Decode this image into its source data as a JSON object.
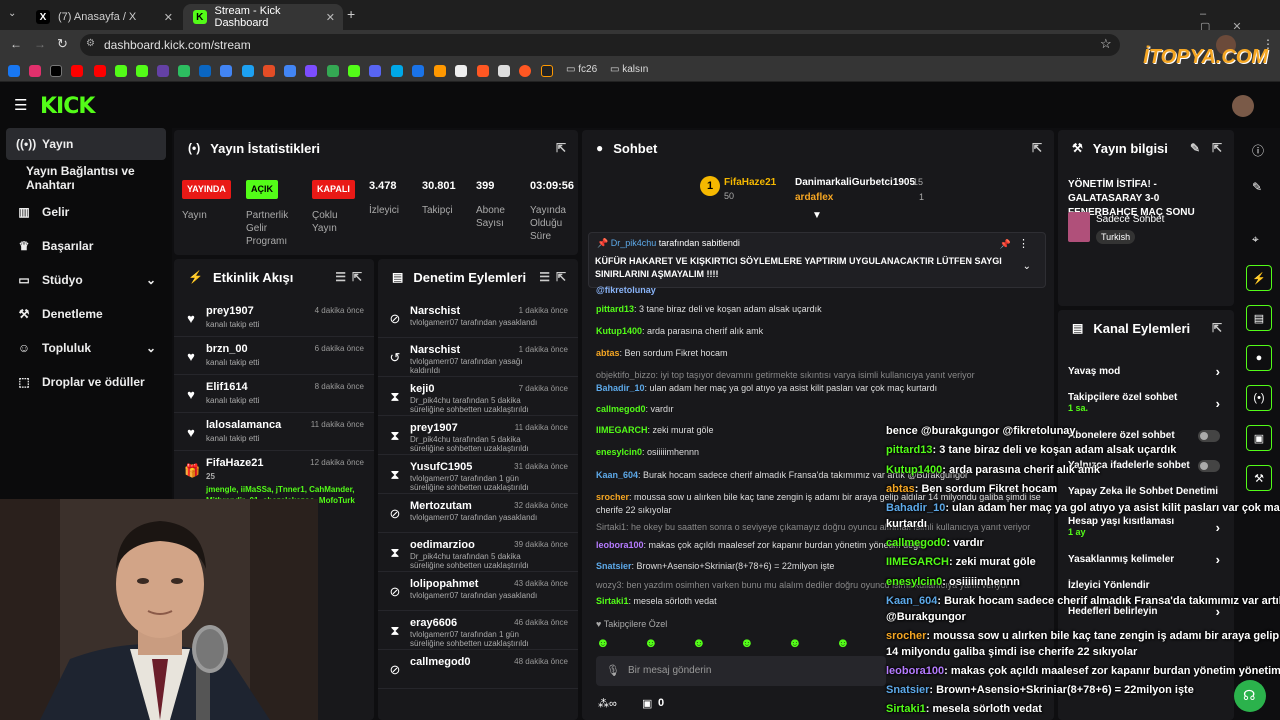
{
  "browser": {
    "tabs": [
      {
        "title": "(7) Anasayfa / X",
        "icon": "x-logo-icon",
        "active": false
      },
      {
        "title": "Stream - Kick Dashboard",
        "icon": "kick-logo-icon",
        "active": true
      }
    ],
    "url": "dashboard.kick.com/stream",
    "bookmarks": [
      {
        "label": "fc26"
      },
      {
        "label": "kalsın"
      }
    ],
    "watermark": "İTOPYA.COM"
  },
  "sidebar": {
    "items": [
      {
        "label": "Yayın",
        "icon": "broadcast-icon"
      },
      {
        "label": "Yayın Bağlantısı ve Anahtarı",
        "icon": ""
      },
      {
        "label": "Gelir",
        "icon": "chart-icon"
      },
      {
        "label": "Başarılar",
        "icon": "trophy-icon"
      },
      {
        "label": "Stüdyo",
        "icon": "studio-icon"
      },
      {
        "label": "Denetleme",
        "icon": "wrench-icon"
      },
      {
        "label": "Topluluk",
        "icon": "community-icon"
      },
      {
        "label": "Droplar ve ödüller",
        "icon": "drops-icon"
      }
    ]
  },
  "stats": {
    "title": "Yayın İstatistikleri",
    "badges": [
      {
        "badge": "YAYINDA",
        "label": "Yayın",
        "color": "#e91916"
      },
      {
        "badge": "AÇIK",
        "label": "Partnerlik Gelir Programı",
        "color": "#53fc18"
      },
      {
        "badge": "KAPALI",
        "label": "Çoklu Yayın",
        "color": "#e91916"
      }
    ],
    "numbers": [
      {
        "value": "3.478",
        "label": "İzleyici"
      },
      {
        "value": "30.801",
        "label": "Takipçi"
      },
      {
        "value": "399",
        "label": "Abone Sayısı"
      },
      {
        "value": "03:09:56",
        "label": "Yayında Olduğu Süre"
      }
    ]
  },
  "activity": {
    "title": "Etkinlik Akışı",
    "items": [
      {
        "name": "prey1907",
        "sub": "kanalı takip etti",
        "time": "4 dakika önce"
      },
      {
        "name": "brzn_00",
        "sub": "kanalı takip etti",
        "time": "6 dakika önce"
      },
      {
        "name": "Elif1614",
        "sub": "kanalı takip etti",
        "time": "8 dakika önce"
      },
      {
        "name": "lalosalamanca",
        "sub": "kanalı takip etti",
        "time": "11 dakika önce"
      },
      {
        "name": "FifaHaze21",
        "sub": "25",
        "time": "12 dakika önce"
      }
    ],
    "gift_names": "jmengle, iiMaSSa, jTnner1, CahMander, Mithrandir_01, shazalakazoo, MofoTurk"
  },
  "moderation": {
    "title": "Denetim Eylemleri",
    "items": [
      {
        "name": "Narschist",
        "sub": "tvlolgamerr07 tarafından yasaklandı",
        "time": "1 dakika önce",
        "icon": "ban-icon"
      },
      {
        "name": "Narschist",
        "sub": "tvlolgamerr07 tarafından yasağı kaldırıldı",
        "time": "1 dakika önce",
        "icon": "unban-icon"
      },
      {
        "name": "keji0",
        "sub": "Dr_pik4chu tarafından 5 dakika süreliğine sohbetten uzaklaştırıldı",
        "time": "7 dakika önce",
        "icon": "timeout-icon"
      },
      {
        "name": "prey1907",
        "sub": "Dr_pik4chu tarafından 5 dakika süreliğine sohbetten uzaklaştırıldı",
        "time": "11 dakika önce",
        "icon": "timeout-icon"
      },
      {
        "name": "YusufC1905",
        "sub": "tvlolgamerr07 tarafından 1 gün süreliğine sohbetten uzaklaştırıldı",
        "time": "31 dakika önce",
        "icon": "timeout-icon"
      },
      {
        "name": "Mertozutam",
        "sub": "tvlolgamerr07 tarafından yasaklandı",
        "time": "32 dakika önce",
        "icon": "ban-icon"
      },
      {
        "name": "oedimarzioo",
        "sub": "Dr_pik4chu tarafından 5 dakika süreliğine sohbetten uzaklaştırıldı",
        "time": "39 dakika önce",
        "icon": "timeout-icon"
      },
      {
        "name": "lolipopahmet",
        "sub": "tvlolgamerr07 tarafından yasaklandı",
        "time": "43 dakika önce",
        "icon": "ban-icon"
      },
      {
        "name": "eray6606",
        "sub": "tvlolgamerr07 tarafından 1 gün süreliğine sohbetten uzaklaştırıldı",
        "time": "46 dakika önce",
        "icon": "timeout-icon"
      },
      {
        "name": "callmegod0",
        "sub": "",
        "time": "48 dakika önce",
        "icon": "ban-icon"
      }
    ]
  },
  "chat": {
    "title": "Sohbet",
    "top": [
      {
        "name": "FifaHaze21",
        "count": "50"
      },
      {
        "name": "DanimarkaliGurbetci1905",
        "count": "15"
      },
      {
        "name": "ardaflex",
        "count": "1"
      }
    ],
    "pinned_by": "Dr_pik4chu",
    "pinned_suffix": "tarafından sabitlendi",
    "pinned_text": "KÜFÜR HAKARET VE KIŞKIRTICI SÖYLEMLERE YAPTIRIM UYGULANACAKTIR LÜTFEN SAYGI SINIRLARINI AŞMAYALIM !!!!",
    "lines": [
      {
        "user": "@fikretolunay",
        "text": "",
        "color": "#8ab4f8"
      },
      {
        "user": "pittard13",
        "text": ": 3 tane biraz deli ve koşan adam alsak uçardık",
        "color": "#53fc18"
      },
      {
        "user": "Kutup1400",
        "text": ": arda parasına cherif alık amk",
        "color": "#53fc18"
      },
      {
        "user": "abtas",
        "text": ": Ben sordum Fikret hocam",
        "color": "#f5a623"
      },
      {
        "user": "",
        "text": "objektifo_bizzo: iyi top taşıyor devamını getirmekte sıkıntısı varya isimli kullanıcıya yanıt veriyor",
        "color": "#888"
      },
      {
        "user": "Bahadir_10",
        "text": ": ulan adam her maç ya gol atıyo ya asist kilit pasları var çok maç kurtardı",
        "color": "#5da9e9"
      },
      {
        "user": "callmegod0",
        "text": ": vardır",
        "color": "#53fc18"
      },
      {
        "user": "IIMEGARCH",
        "text": ": zeki murat göle",
        "color": "#53fc18"
      },
      {
        "user": "enesylcin0",
        "text": ": osiiiiimhennn",
        "color": "#53fc18"
      },
      {
        "user": "Kaan_604",
        "text": ": Burak hocam sadece cherif almadık Fransa'da takımımız var artık @Burakgungor",
        "color": "#5da9e9"
      },
      {
        "user": "srocher",
        "text": ": moussa sow u alırken bile kaç tane zengin iş adamı bir araya gelip aldılar 14 milyondu galiba şimdi ise cherife 22 sıkıyolar",
        "color": "#f5a623"
      },
      {
        "user": "",
        "text": "Sirtaki1: he okey bu saatten sonra o seviyeye çıkamayız doğru oyuncu alınmalı isimli kullanıcıya yanıt veriyor",
        "color": "#888"
      },
      {
        "user": "leobora100",
        "text": ": makas çok açıldı maalesef zor kapanır burdan yönetim yönetim değil",
        "color": "#b57bff"
      },
      {
        "user": "Snatsier",
        "text": ": Brown+Asensio+Skriniar(8+78+6) = 22milyon işte",
        "color": "#5da9e9"
      },
      {
        "user": "",
        "text": "wozy3: ben yazdım osimhen varken bunu mu alalım dediler doğru oyuncu isimli kullanıcıya yanıt veriyor",
        "color": "#888"
      },
      {
        "user": "Sirtaki1",
        "text": ": mesela sörloth vedat",
        "color": "#53fc18"
      }
    ],
    "followers_only": "Takipçilere Özel",
    "input_placeholder": "Bir mesaj gönderin",
    "footer_count": "0"
  },
  "stream_info": {
    "title": "Yayın bilgisi",
    "stream_title": "YÖNETİM İSTİFA! - GALATASARAY 3-0 FENERBAHÇE MAÇ SONU",
    "category": "Sadece Sohbet",
    "language": "Turkish"
  },
  "channel_actions": {
    "title": "Kanal Eylemleri",
    "rows": [
      {
        "label": "Yavaş mod",
        "sub": ""
      },
      {
        "label": "Takipçilere özel sohbet",
        "sub": "1 sa."
      },
      {
        "label": "Abonelere özel sohbet",
        "sub": ""
      },
      {
        "label": "Yalnızca ifadelerle sohbet",
        "sub": ""
      },
      {
        "label": "Yapay Zeka ile Sohbet Denetimi",
        "sub": ""
      },
      {
        "label": "Hesap yaşı kısıtlaması",
        "sub": "1 ay"
      },
      {
        "label": "Yasaklanmış kelimeler",
        "sub": ""
      },
      {
        "label": "İzleyici Yönlendir",
        "sub": ""
      },
      {
        "label": "Hedefleri belirleyin",
        "sub": ""
      }
    ]
  },
  "overlay": {
    "lines": [
      {
        "user": "bence @burakgungor @fikretolunay",
        "text": "",
        "color": "#fff"
      },
      {
        "user": "pittard13",
        "text": ": 3 tane biraz deli ve koşan adam alsak uçardık",
        "color": "#53fc18"
      },
      {
        "user": "Kutup1400",
        "text": ": arda parasına cherif alık amk",
        "color": "#53fc18"
      },
      {
        "user": "abtas",
        "text": ": Ben sordum Fikret hocam",
        "color": "#f5a623"
      },
      {
        "user": "Bahadir_10",
        "text": ": ulan adam her maç ya gol atıyo ya asist kilit pasları var çok maç",
        "color": "#5da9e9"
      },
      {
        "user": "",
        "text": "kurtardı",
        "color": "#fff"
      },
      {
        "user": "callmegod0",
        "text": ": vardır",
        "color": "#53fc18"
      },
      {
        "user": "IIMEGARCH",
        "text": ": zeki murat göle",
        "color": "#53fc18"
      },
      {
        "user": "enesylcin0",
        "text": ": osiiiiimhennn",
        "color": "#53fc18"
      },
      {
        "user": "Kaan_604",
        "text": ": Burak hocam sadece cherif almadık Fransa'da takımımız var artık",
        "color": "#5da9e9"
      },
      {
        "user": "",
        "text": "@Burakgungor",
        "color": "#fff"
      },
      {
        "user": "srocher",
        "text": ": moussa sow u alırken bile kaç tane zengin iş adamı bir araya gelip aldılar",
        "color": "#f5a623"
      },
      {
        "user": "",
        "text": "14 milyondu galiba şimdi ise cherife 22 sıkıyolar",
        "color": "#fff"
      },
      {
        "user": "leobora100",
        "text": ": makas çok açıldı maalesef zor kapanır burdan yönetim yönetim değil",
        "color": "#b57bff"
      },
      {
        "user": "Snatsier",
        "text": ": Brown+Asensio+Skriniar(8+78+6) = 22milyon işte",
        "color": "#5da9e9"
      },
      {
        "user": "Sirtaki1",
        "text": ": mesela sörloth vedat",
        "color": "#53fc18"
      }
    ]
  }
}
